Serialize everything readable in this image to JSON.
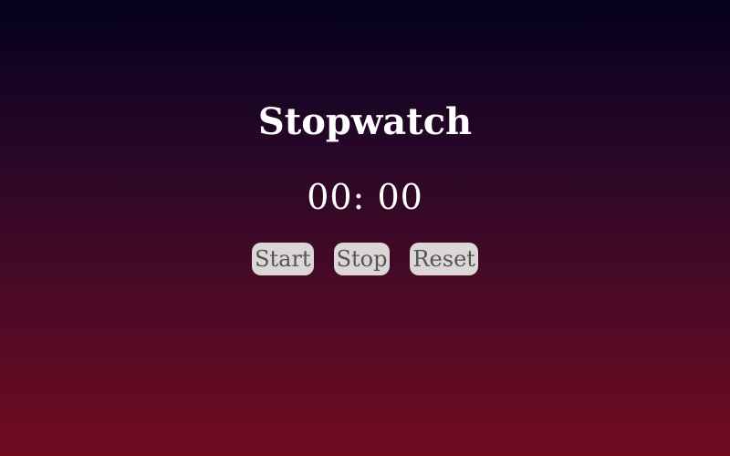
{
  "app": {
    "title": "Stopwatch"
  },
  "display": {
    "time": "00: 00"
  },
  "controls": {
    "start_label": "Start",
    "stop_label": "Stop",
    "reset_label": "Reset"
  },
  "colors": {
    "background_top": "#03001e",
    "background_bottom": "#720b1f",
    "button_bg": "#dcd6d6",
    "button_text": "#555555",
    "text": "#ffffff"
  }
}
